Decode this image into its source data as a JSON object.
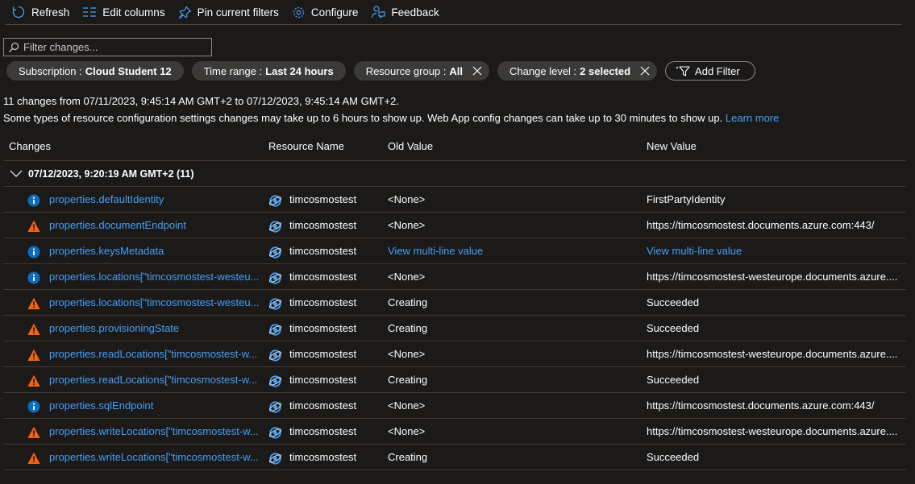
{
  "toolbar": {
    "refresh": "Refresh",
    "edit_columns": "Edit columns",
    "pin_filters": "Pin current filters",
    "configure": "Configure",
    "feedback": "Feedback"
  },
  "search": {
    "placeholder": "Filter changes..."
  },
  "filters": [
    {
      "label": "Subscription :",
      "value": "Cloud Student 12"
    },
    {
      "label": "Time range :",
      "value": "Last 24 hours"
    },
    {
      "label": "Resource group :",
      "value": "All"
    },
    {
      "label": "Change level :",
      "value": "2 selected"
    }
  ],
  "add_filter": "Add Filter",
  "info": {
    "summary": "11 changes from 07/11/2023, 9:45:14 AM GMT+2 to 07/12/2023, 9:45:14 AM GMT+2.",
    "note": "Some types of resource configuration settings changes may take up to 6 hours to show up. Web App config changes can take up to 30 minutes to show up.",
    "learn_more": "Learn more"
  },
  "columns": {
    "changes": "Changes",
    "resource_name": "Resource Name",
    "old_value": "Old Value",
    "new_value": "New Value"
  },
  "group": {
    "label": "07/12/2023, 9:20:19 AM GMT+2 (11)"
  },
  "colors": {
    "link": "#479ef5",
    "info": "#0f6cbd",
    "warning": "#f7630c",
    "background": "#1b1a19"
  },
  "rows": [
    {
      "level": "info",
      "change": "properties.defaultIdentity",
      "resource": "timcosmostest",
      "old": "<None>",
      "new": "FirstPartyIdentity"
    },
    {
      "level": "warning",
      "change": "properties.documentEndpoint",
      "resource": "timcosmostest",
      "old": "<None>",
      "new": "https://timcosmostest.documents.azure.com:443/"
    },
    {
      "level": "info",
      "change": "properties.keysMetadata",
      "resource": "timcosmostest",
      "old": "View multi-line value",
      "new": "View multi-line value"
    },
    {
      "level": "info",
      "change": "properties.locations[\"timcosmostest-westeu...",
      "resource": "timcosmostest",
      "old": "<None>",
      "new": "https://timcosmostest-westeurope.documents.azure...."
    },
    {
      "level": "warning",
      "change": "properties.locations[\"timcosmostest-westeu...",
      "resource": "timcosmostest",
      "old": "Creating",
      "new": "Succeeded"
    },
    {
      "level": "warning",
      "change": "properties.provisioningState",
      "resource": "timcosmostest",
      "old": "Creating",
      "new": "Succeeded"
    },
    {
      "level": "warning",
      "change": "properties.readLocations[\"timcosmostest-w...",
      "resource": "timcosmostest",
      "old": "<None>",
      "new": "https://timcosmostest-westeurope.documents.azure...."
    },
    {
      "level": "warning",
      "change": "properties.readLocations[\"timcosmostest-w...",
      "resource": "timcosmostest",
      "old": "Creating",
      "new": "Succeeded"
    },
    {
      "level": "info",
      "change": "properties.sqlEndpoint",
      "resource": "timcosmostest",
      "old": "<None>",
      "new": "https://timcosmostest.documents.azure.com:443/"
    },
    {
      "level": "warning",
      "change": "properties.writeLocations[\"timcosmostest-w...",
      "resource": "timcosmostest",
      "old": "<None>",
      "new": "https://timcosmostest-westeurope.documents.azure...."
    },
    {
      "level": "warning",
      "change": "properties.writeLocations[\"timcosmostest-w...",
      "resource": "timcosmostest",
      "old": "Creating",
      "new": "Succeeded"
    }
  ]
}
